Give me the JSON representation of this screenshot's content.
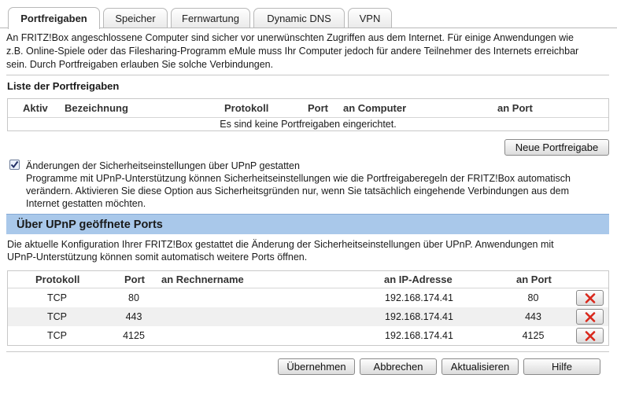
{
  "tabs": [
    {
      "label": "Portfreigaben",
      "active": true
    },
    {
      "label": "Speicher"
    },
    {
      "label": "Fernwartung"
    },
    {
      "label": "Dynamic DNS"
    },
    {
      "label": "VPN"
    }
  ],
  "intro": {
    "line1": "An FRITZ!Box angeschlossene Computer sind sicher vor unerwünschten Zugriffen aus dem Internet. Für einige Anwendungen wie",
    "line2": "z.B. Online-Spiele oder das Filesharing-Programm eMule muss Ihr Computer jedoch für andere Teilnehmer des Internets erreichbar",
    "line3": "sein. Durch Portfreigaben erlauben Sie solche Verbindungen."
  },
  "portfreigaben": {
    "heading": "Liste der Portfreigaben",
    "columns": {
      "aktiv": "Aktiv",
      "bezeichnung": "Bezeichnung",
      "protokoll": "Protokoll",
      "port": "Port",
      "an_computer": "an Computer",
      "an_port": "an Port"
    },
    "empty_text": "Es sind keine Portfreigaben eingerichtet.",
    "new_button": "Neue Portfreigabe"
  },
  "upnp_option": {
    "checked": true,
    "label": "Änderungen der Sicherheitseinstellungen über UPnP gestatten",
    "desc1": "Programme mit UPnP-Unterstützung können Sicherheitseinstellungen wie die Portfreigaberegeln der FRITZ!Box automatisch",
    "desc2": "verändern. Aktivieren Sie diese Option aus Sicherheitsgründen nur, wenn Sie tatsächlich eingehende Verbindungen aus dem",
    "desc3": "Internet gestatten möchten."
  },
  "upnp_ports": {
    "heading": "Über UPnP geöffnete Ports",
    "desc1": "Die aktuelle Konfiguration Ihrer FRITZ!Box gestattet die Änderung der Sicherheitseinstellungen über UPnP. Anwendungen mit",
    "desc2": "UPnP-Unterstützung können somit automatisch weitere Ports öffnen.",
    "columns": {
      "protokoll": "Protokoll",
      "port": "Port",
      "rechnername": "an Rechnername",
      "ip": "an IP-Adresse",
      "an_port": "an Port"
    },
    "rows": [
      {
        "protokoll": "TCP",
        "port": "80",
        "rechnername": "",
        "ip": "192.168.174.41",
        "an_port": "80"
      },
      {
        "protokoll": "TCP",
        "port": "443",
        "rechnername": "",
        "ip": "192.168.174.41",
        "an_port": "443"
      },
      {
        "protokoll": "TCP",
        "port": "4125",
        "rechnername": "",
        "ip": "192.168.174.41",
        "an_port": "4125"
      }
    ],
    "delete_icon": "red-x-icon"
  },
  "footer": {
    "apply": "Übernehmen",
    "cancel": "Abbrechen",
    "refresh": "Aktualisieren",
    "help": "Hilfe"
  },
  "colors": {
    "section_bar": "#a9c8ea",
    "delete_x": "#d9281c"
  }
}
